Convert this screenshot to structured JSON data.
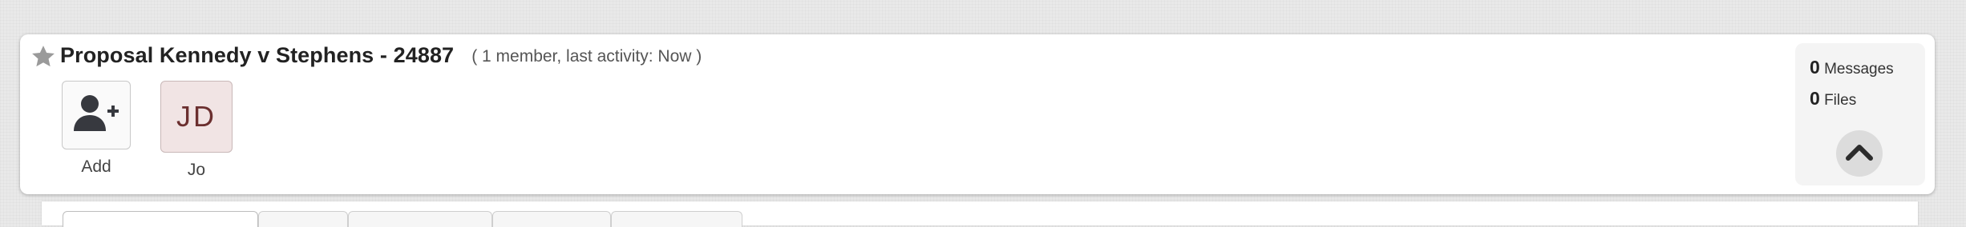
{
  "group": {
    "title": "Proposal Kennedy v Stephens - 24887",
    "meta_text": "( 1 member, last activity: Now )"
  },
  "members": {
    "add_label": "Add",
    "avatar_initials": "JD",
    "avatar_name": "Jo"
  },
  "stats": {
    "messages_count": "0",
    "messages_label": "Messages",
    "files_count": "0",
    "files_label": "Files"
  },
  "icons": {
    "favorite": "star-icon",
    "add_member": "add-user-icon",
    "collapse": "chevron-up-icon"
  },
  "colors": {
    "avatar_bg": "#f1e4e4",
    "avatar_text": "#6b2f2f",
    "icon_dark": "#37393f",
    "star": "#9a9a9a"
  }
}
